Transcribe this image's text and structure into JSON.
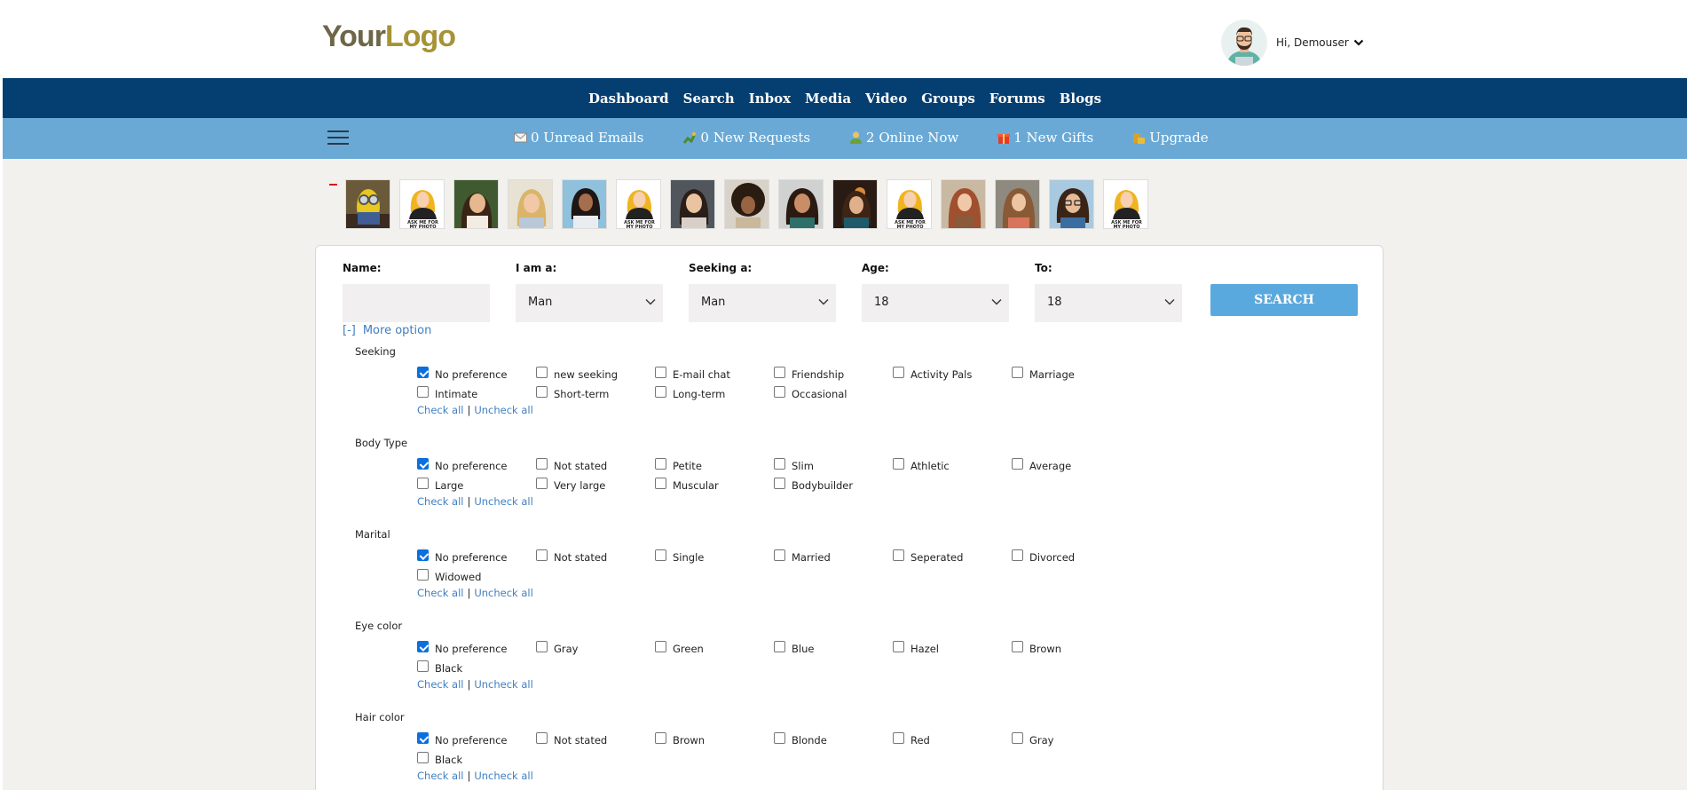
{
  "header": {
    "logo_part1": "Your",
    "logo_part2": "Logo",
    "greeting": "Hi, Demouser"
  },
  "nav": [
    "Dashboard",
    "Search",
    "Inbox",
    "Media",
    "Video",
    "Groups",
    "Forums",
    "Blogs"
  ],
  "status_bar": [
    {
      "label": "0 Unread Emails",
      "icon": "envelope-icon"
    },
    {
      "label": "0 New Requests",
      "icon": "request-icon"
    },
    {
      "label": "2 Online Now",
      "icon": "online-user-icon"
    },
    {
      "label": "1 New Gifts",
      "icon": "gift-icon"
    },
    {
      "label": "Upgrade",
      "icon": "coins-icon"
    }
  ],
  "placeholder_text": "ASK ME FOR MY PHOTO",
  "search": {
    "name_label": "Name:",
    "iam_label": "I am a:",
    "iam_value": "Man",
    "seeking_label": "Seeking a:",
    "seeking_value": "Man",
    "age_label": "Age:",
    "age_value": "18",
    "to_label": "To:",
    "to_value": "18",
    "button": "SEARCH",
    "more_toggle": "[-]",
    "more_label": "More option"
  },
  "check_all": "Check all",
  "separator": "|",
  "uncheck_all": "Uncheck all",
  "sections": [
    {
      "title": "Seeking",
      "options": [
        "No preference",
        "new seeking",
        "E-mail chat",
        "Friendship",
        "Activity Pals",
        "Marriage",
        "Intimate",
        "Short-term",
        "Long-term",
        "Occasional"
      ]
    },
    {
      "title": "Body Type",
      "options": [
        "No preference",
        "Not stated",
        "Petite",
        "Slim",
        "Athletic",
        "Average",
        "Large",
        "Very large",
        "Muscular",
        "Bodybuilder"
      ]
    },
    {
      "title": "Marital",
      "options": [
        "No preference",
        "Not stated",
        "Single",
        "Married",
        "Seperated",
        "Divorced",
        "Widowed"
      ]
    },
    {
      "title": "Eye color",
      "options": [
        "No preference",
        "Gray",
        "Green",
        "Blue",
        "Hazel",
        "Brown",
        "Black"
      ]
    },
    {
      "title": "Hair color",
      "options": [
        "No preference",
        "Not stated",
        "Brown",
        "Blonde",
        "Red",
        "Gray",
        "Black"
      ]
    }
  ]
}
